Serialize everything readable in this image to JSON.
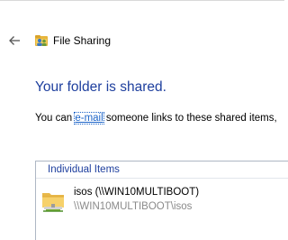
{
  "header": {
    "title": "File Sharing"
  },
  "main": {
    "heading": "Your folder is shared.",
    "message_prefix": "You can ",
    "email_link": "e-mail",
    "message_suffix": " someone links to these shared items,"
  },
  "items_group": {
    "header": "Individual Items",
    "items": [
      {
        "name": "isos (\\\\WIN10MULTIBOOT)",
        "path": "\\\\WIN10MULTIBOOT\\isos",
        "icon": "shared-folder-icon"
      }
    ]
  },
  "colors": {
    "heading": "#1e3f9e",
    "link": "#1c64c8",
    "secondary_text": "#8a8a8a",
    "group_border": "#aeb7c4"
  }
}
